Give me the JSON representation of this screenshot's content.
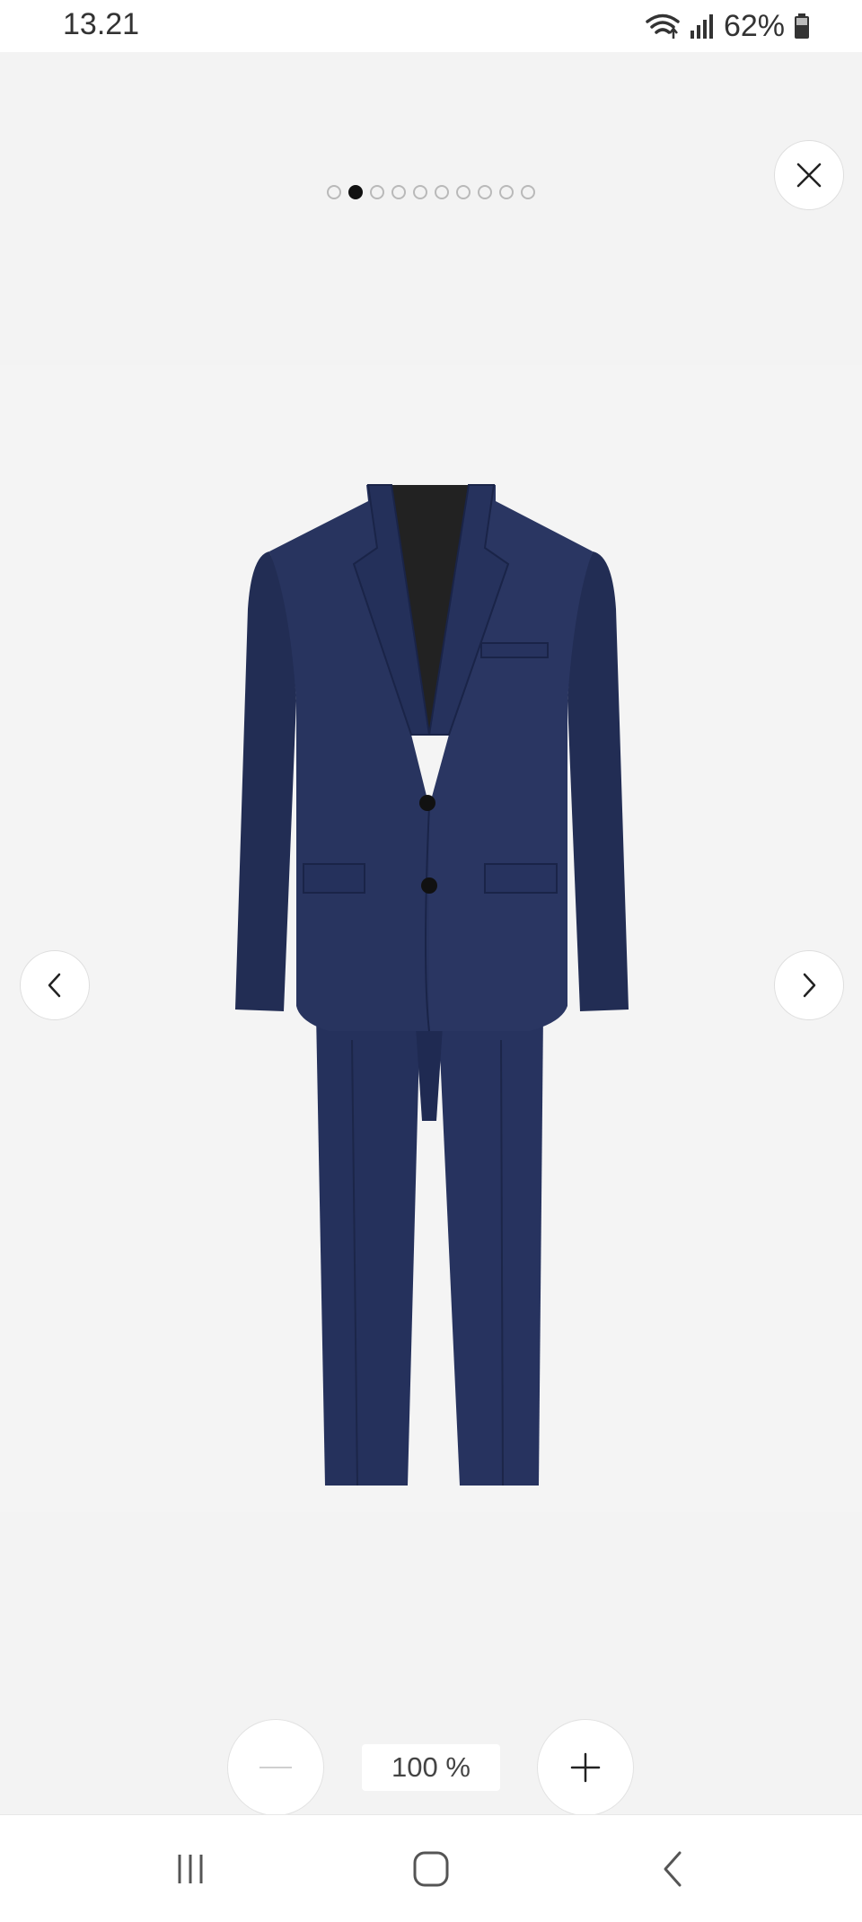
{
  "status": {
    "time": "13.21",
    "battery": "62%",
    "icons": [
      "wifi-icon",
      "signal-icon",
      "battery-icon"
    ]
  },
  "gallery": {
    "image_count": 10,
    "active_index": 1,
    "product_image": "navy-suit-image",
    "colors": {
      "suit": "#25315c",
      "lining": "#222222"
    }
  },
  "zoom": {
    "level_label": "100 %",
    "decrease_icon": "minus-icon",
    "increase_icon": "plus-icon"
  },
  "controls": {
    "close_icon": "close-icon",
    "prev_icon": "chevron-left-icon",
    "next_icon": "chevron-right-icon"
  },
  "navigation": {
    "recents_icon": "recents-icon",
    "home_icon": "home-icon",
    "back_icon": "back-icon"
  }
}
